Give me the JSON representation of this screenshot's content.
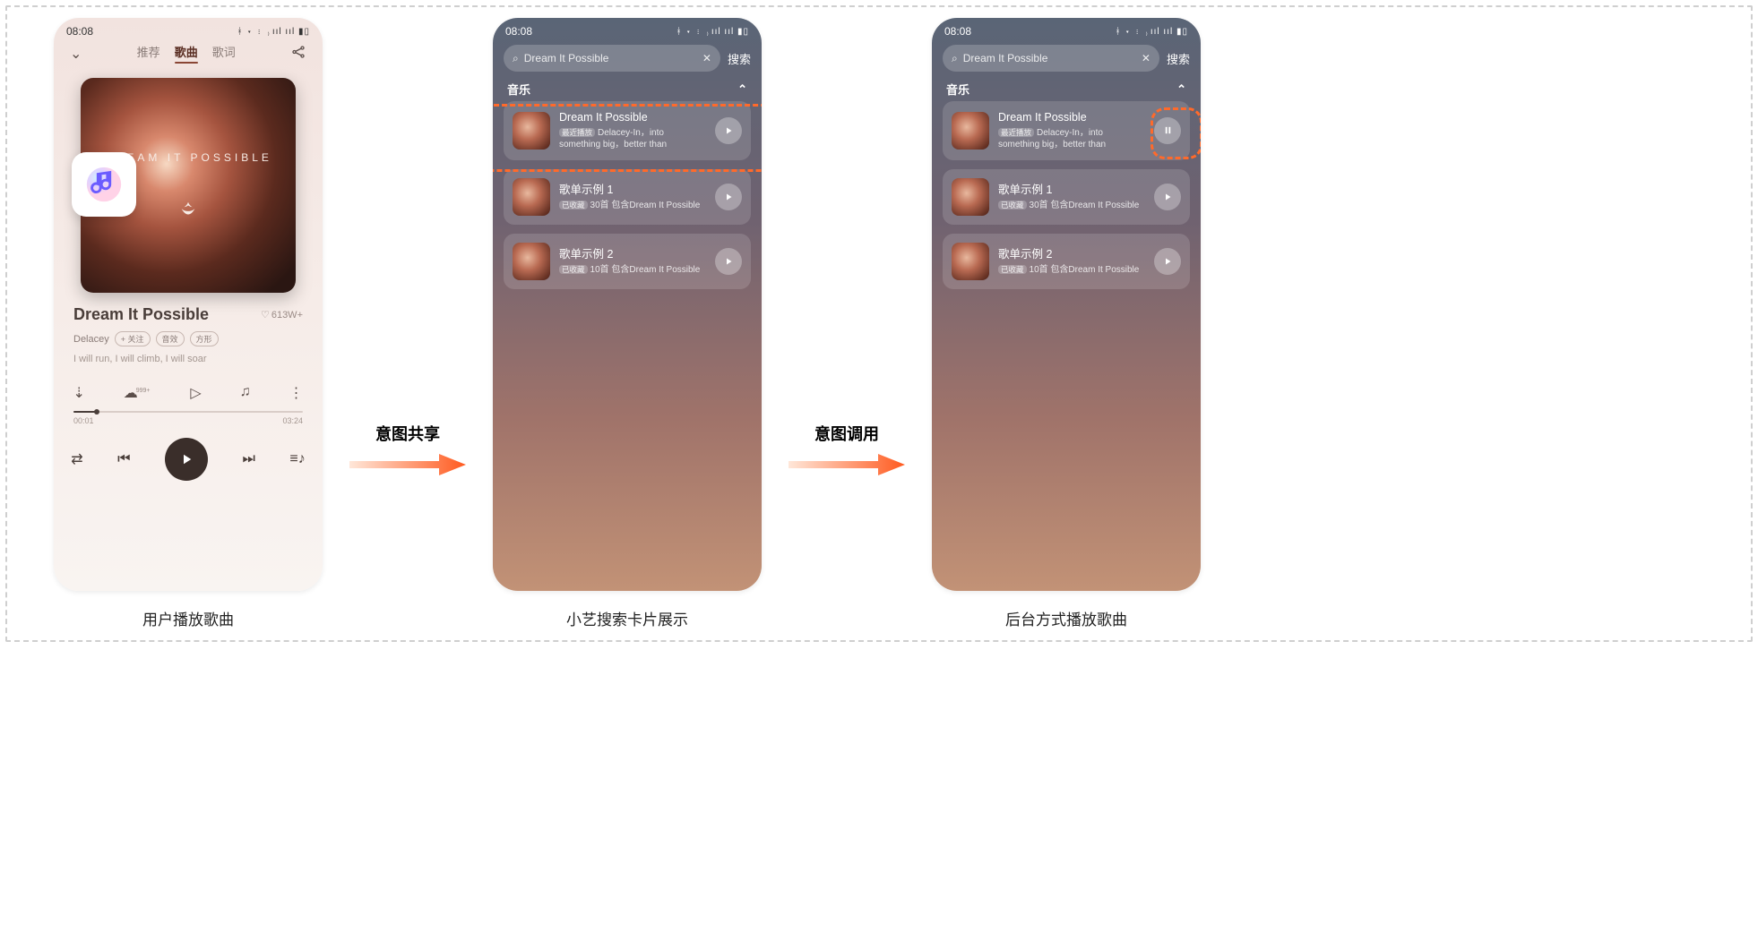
{
  "status_time": "08:08",
  "player": {
    "tabs": [
      "推荐",
      "歌曲",
      "歌词"
    ],
    "active_tab": 1,
    "cover_title": "DREAM IT POSSIBLE",
    "song_title": "Dream It Possible",
    "like_count": "613W+",
    "artist": "Delacey",
    "pills": [
      "+ 关注",
      "音效",
      "方形"
    ],
    "lyric_preview": "I will run, I will climb, I will soar",
    "comment_badge": "999+",
    "time_elapsed": "00:01",
    "time_total": "03:24"
  },
  "arrows": {
    "share_label": "意图共享",
    "invoke_label": "意图调用"
  },
  "captions": {
    "c1": "用户播放歌曲",
    "c2": "小艺搜索卡片展示",
    "c3": "后台方式播放歌曲"
  },
  "search": {
    "placeholder": "Dream It Possible",
    "search_btn": "搜索",
    "section": "音乐",
    "cards": [
      {
        "title": "Dream It Possible",
        "tag": "最近播放",
        "sub": "Delacey-In，into something big，better than"
      },
      {
        "title": "歌单示例 1",
        "tag": "已收藏",
        "sub": "30首 包含Dream It Possible"
      },
      {
        "title": "歌单示例 2",
        "tag": "已收藏",
        "sub": "10首 包含Dream It Possible"
      }
    ]
  }
}
